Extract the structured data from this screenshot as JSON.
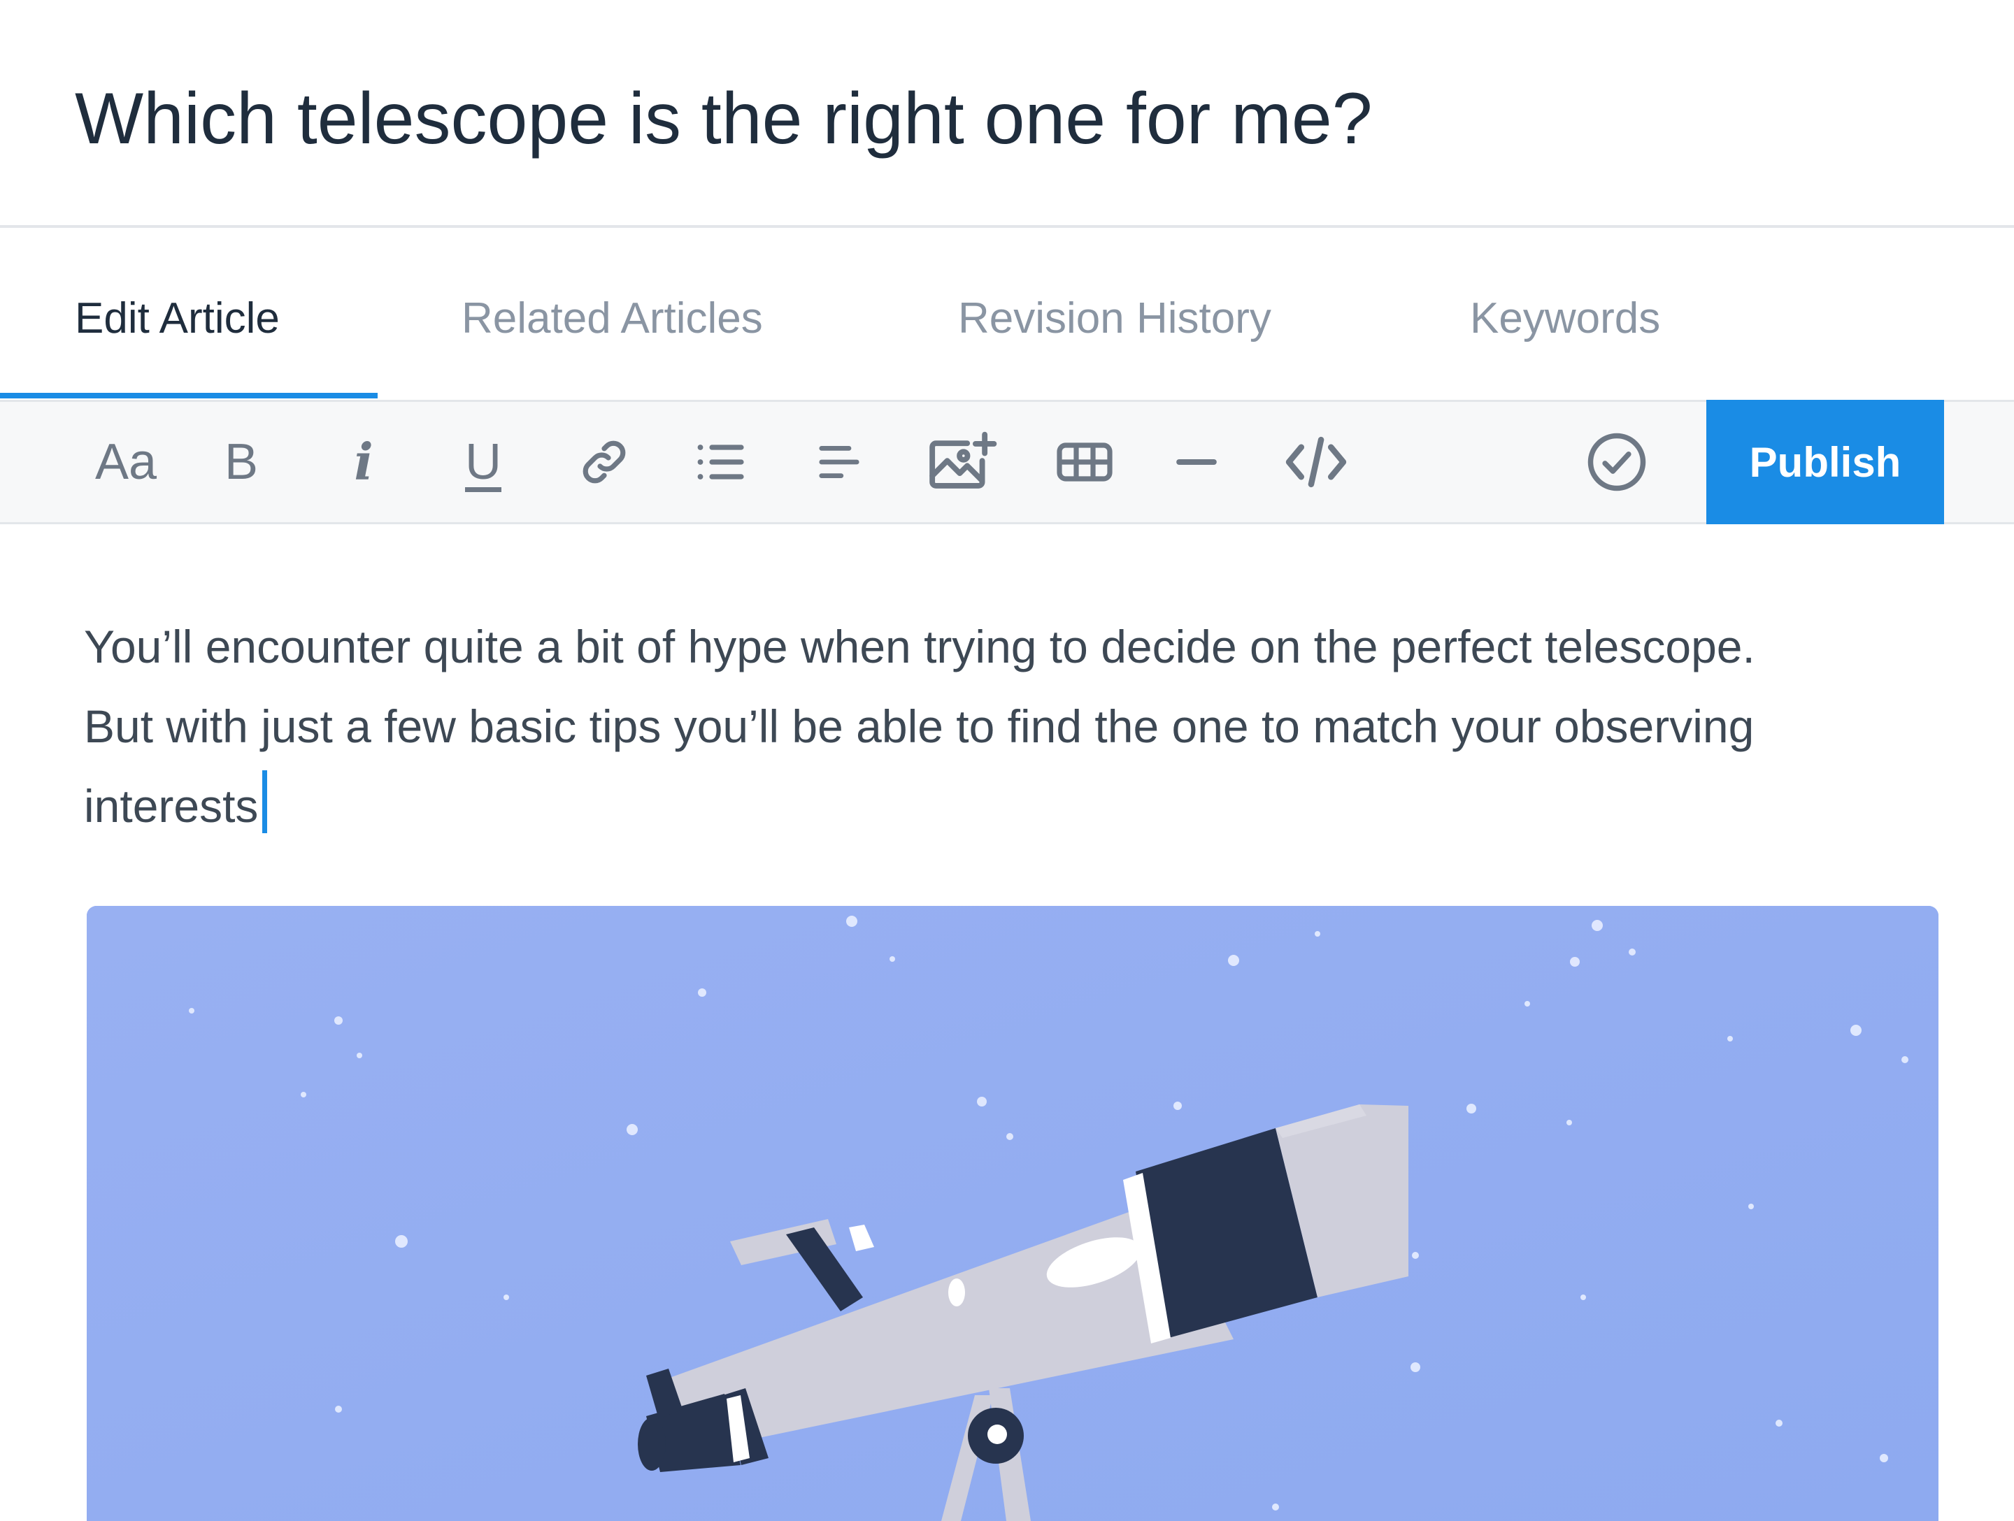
{
  "article": {
    "title": "Which telescope is the right one for me?"
  },
  "tabs": [
    {
      "label": "Edit Article",
      "active": true
    },
    {
      "label": "Related Articles",
      "active": false
    },
    {
      "label": "Revision History",
      "active": false
    },
    {
      "label": "Keywords",
      "active": false
    }
  ],
  "toolbar": {
    "font_label": "Aa",
    "bold_label": "B",
    "italic_label": "i",
    "underline_label": "U",
    "icons": [
      "font-size-icon",
      "bold-icon",
      "italic-icon",
      "underline-icon",
      "link-icon",
      "bulleted-list-icon",
      "align-left-icon",
      "insert-image-icon",
      "table-icon",
      "horizontal-rule-icon",
      "code-icon",
      "check-circle-icon"
    ],
    "publish_label": "Publish"
  },
  "editor": {
    "lines": [
      "You’ll encounter quite a bit of hype when trying to decide on the perfect telescope.",
      "But with just a few basic tips you’ll be able to find the one to match your observing",
      "interests"
    ]
  },
  "colors": {
    "accent": "#1a8ce5",
    "text_dark": "#1f2d3d",
    "tab_inactive": "#8a95a3",
    "image_bg": "#95aef2",
    "telescope_dark": "#27344f",
    "telescope_light": "#cfcfdb"
  }
}
